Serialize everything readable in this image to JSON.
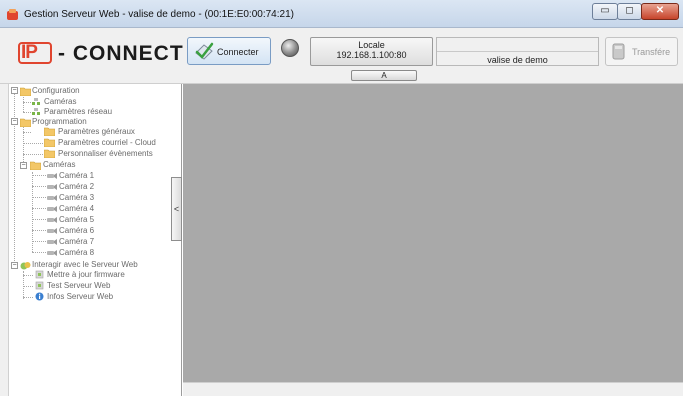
{
  "window": {
    "title": "Gestion Serveur Web - valise de demo - (00:1E:E0:00:74:21)",
    "min_glyph": "▭",
    "max_glyph": "◻",
    "close_glyph": "✕"
  },
  "logo": {
    "ip": "IP",
    "connect": "- CONNECT"
  },
  "toolbar": {
    "connect_label": "Connecter",
    "locale_name": "Locale",
    "locale_address": "192.168.1.100:80",
    "a_button": "A",
    "device_name": "valise de demo",
    "transfer_label": "Transfére"
  },
  "tree": {
    "configuration": "Configuration",
    "config_cameras": "Caméras",
    "config_network": "Paramètres réseau",
    "programmation": "Programmation",
    "prog_general": "Paramètres généraux",
    "prog_email_cloud": "Paramètres courriel - Cloud",
    "prog_events": "Personnaliser évènements",
    "prog_cameras": "Caméras",
    "camera_1": "Caméra 1",
    "camera_2": "Caméra 2",
    "camera_3": "Caméra 3",
    "camera_4": "Caméra 4",
    "camera_5": "Caméra 5",
    "camera_6": "Caméra 6",
    "camera_7": "Caméra 7",
    "camera_8": "Caméra 8",
    "interact": "Interagir avec le Serveur Web",
    "update_firmware": "Mettre à jour firmware",
    "test_server": "Test Serveur Web",
    "info_server": "Infos Serveur Web",
    "collapse_glyph": "<"
  },
  "colors": {
    "logo_red": "#e0452f",
    "main_gray": "#a9a9a9",
    "tree_text": "#6b6b6b"
  }
}
